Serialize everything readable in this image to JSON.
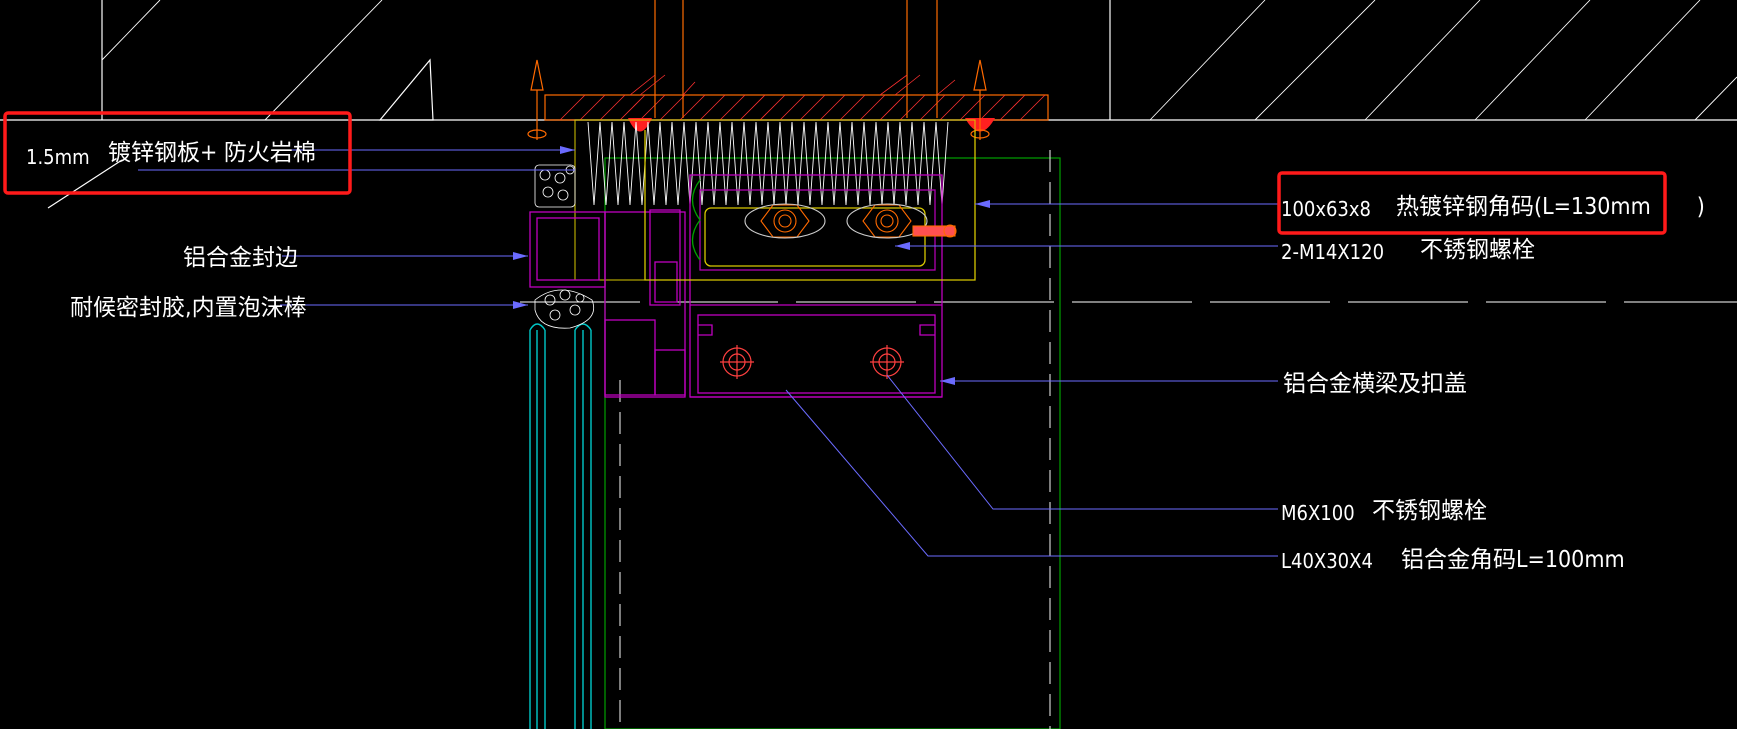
{
  "colors": {
    "background": "#000000",
    "leader": "#6b6bff",
    "highlight_box": "#ff1a1a",
    "profile": "#c000c0",
    "glass": "#00c8c8",
    "steel": "#d8c800",
    "insulation": "#ffffff",
    "bracket_green": "#00a000",
    "orange": "#ff6a00",
    "hatch": "#ff3030"
  },
  "annotations": {
    "steel_plate_thickness": "1.5mm",
    "steel_plate": "镀锌钢板+ 防火岩棉",
    "aluminum_edge": "铝合金封边",
    "sealant": "耐候密封胶,内置泡沫棒",
    "angle_size": "100x63x8",
    "angle_desc": "热镀锌钢角码(L=130mm　　)",
    "bolt_m14_size": "2-M14X120",
    "bolt_m14_desc": "不锈钢螺栓",
    "transom": "铝合金横梁及扣盖",
    "bolt_m6_size": "M6X100",
    "bolt_m6_desc": "不锈钢螺栓",
    "alu_angle_size": "L40X30X4",
    "alu_angle_desc": "铝合金角码L=100mm"
  },
  "icons": [
    "anchor-bolt-icon",
    "hex-bolt-icon",
    "screw-icon"
  ]
}
